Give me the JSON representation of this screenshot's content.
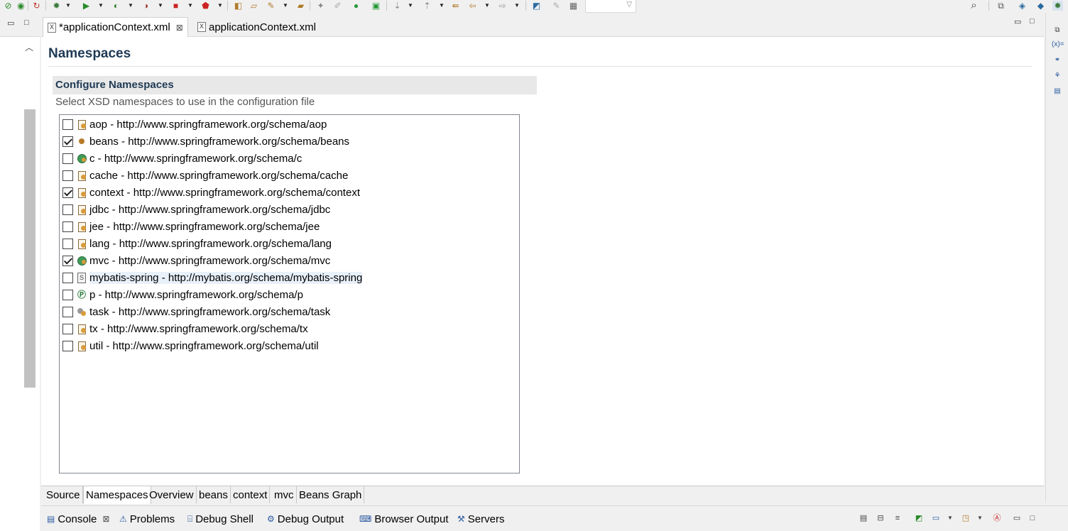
{
  "toolbar": {
    "icons": [
      "debug-icon",
      "run-icon",
      "coverage-icon",
      "profile-icon",
      "stop-icon",
      "deploy-icon",
      "new-java-project-icon",
      "open-type-icon",
      "search-icon-tool",
      "open-task-icon",
      "annotation-icon",
      "skip-breakpoints-icon",
      "console-icon",
      "terminate-icon",
      "step-icon",
      "next-annotation-icon",
      "prev-annotation-icon",
      "back-icon",
      "forward-icon",
      "pin-icon",
      "link-icon"
    ],
    "glyphs": {
      "debug": "✹",
      "run": "▶",
      "stop": "■",
      "search": "⌕",
      "back": "⇦",
      "forward": "⇨",
      "grid": "▦",
      "perspective_open": "⧉"
    }
  },
  "editor": {
    "tabs": [
      {
        "label": "*applicationContext.xml",
        "icon": "X",
        "close": "⊠"
      },
      {
        "label": "applicationContext.xml",
        "icon": "X"
      }
    ],
    "minimize": "▭",
    "maximize": "□"
  },
  "namespaces_page": {
    "title": "Namespaces",
    "section_title": "Configure Namespaces",
    "description": "Select XSD namespaces to use in the configuration file",
    "items": [
      {
        "label": "aop - http://www.springframework.org/schema/aop",
        "checked": false,
        "icon": "doc"
      },
      {
        "label": "beans - http://www.springframework.org/schema/beans",
        "checked": true,
        "icon": "bean"
      },
      {
        "label": "c - http://www.springframework.org/schema/c",
        "checked": false,
        "icon": "globe"
      },
      {
        "label": "cache - http://www.springframework.org/schema/cache",
        "checked": false,
        "icon": "doc"
      },
      {
        "label": "context - http://www.springframework.org/schema/context",
        "checked": true,
        "icon": "doc"
      },
      {
        "label": "jdbc - http://www.springframework.org/schema/jdbc",
        "checked": false,
        "icon": "doc"
      },
      {
        "label": "jee - http://www.springframework.org/schema/jee",
        "checked": false,
        "icon": "doc"
      },
      {
        "label": "lang - http://www.springframework.org/schema/lang",
        "checked": false,
        "icon": "doc"
      },
      {
        "label": "mvc - http://www.springframework.org/schema/mvc",
        "checked": true,
        "icon": "globe"
      },
      {
        "label": "mybatis-spring - http://mybatis.org/schema/mybatis-spring",
        "checked": false,
        "icon": "sdoc",
        "selected": true
      },
      {
        "label": "p - http://www.springframework.org/schema/p",
        "checked": false,
        "icon": "pcirc",
        "glyph": "Ⓟ"
      },
      {
        "label": "task - http://www.springframework.org/schema/task",
        "checked": false,
        "icon": "gear"
      },
      {
        "label": "tx - http://www.springframework.org/schema/tx",
        "checked": false,
        "icon": "doc"
      },
      {
        "label": "util - http://www.springframework.org/schema/util",
        "checked": false,
        "icon": "doc"
      }
    ]
  },
  "page_tabs": [
    {
      "label": "Source",
      "active": false
    },
    {
      "label": "Namespaces",
      "active": true
    },
    {
      "label": "Overview",
      "active": false
    },
    {
      "label": "beans",
      "active": false
    },
    {
      "label": "context",
      "active": false
    },
    {
      "label": "mvc",
      "active": false
    },
    {
      "label": "Beans Graph",
      "active": false
    }
  ],
  "console_panel": {
    "tabs": [
      {
        "label": "Console",
        "icon": "▤",
        "close": "⊠"
      },
      {
        "label": "Problems",
        "icon": "⚠"
      },
      {
        "label": "Debug Shell",
        "icon": "⌸"
      },
      {
        "label": "Debug Output",
        "icon": "⚙"
      },
      {
        "label": "Browser Output",
        "icon": "⌨"
      },
      {
        "label": "Servers",
        "icon": "⚒"
      }
    ]
  },
  "right_trim": {
    "variables_label": "(x)="
  },
  "colors": {
    "title": "#1f3a55",
    "section_bg": "#e8e8e8",
    "selection_bg": "#e8f0fa",
    "scroll_thumb": "#c1c1c1"
  }
}
